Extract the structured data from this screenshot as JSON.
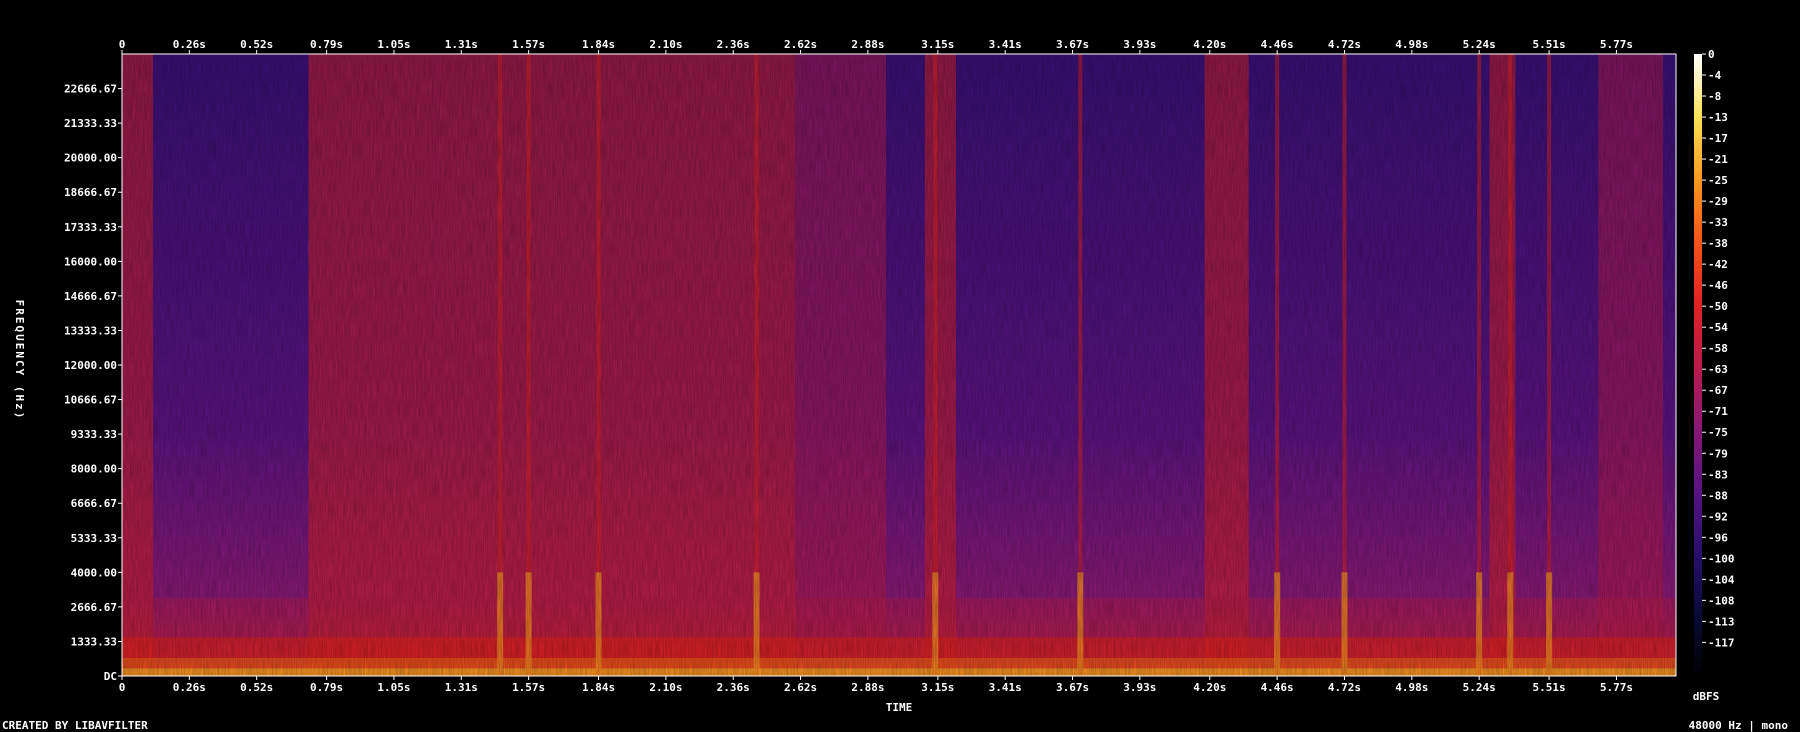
{
  "chart_data": {
    "type": "heatmap",
    "title": "",
    "xlabel": "TIME",
    "ylabel": "FREQUENCY (Hz)",
    "x_ticks": [
      "0",
      "0.26s",
      "0.52s",
      "0.79s",
      "1.05s",
      "1.31s",
      "1.57s",
      "1.84s",
      "2.10s",
      "2.36s",
      "2.62s",
      "2.88s",
      "3.15s",
      "3.41s",
      "3.67s",
      "3.93s",
      "4.20s",
      "4.46s",
      "4.72s",
      "4.98s",
      "5.24s",
      "5.51s",
      "5.77s"
    ],
    "x_tick_values": [
      0,
      0.26,
      0.52,
      0.79,
      1.05,
      1.31,
      1.57,
      1.84,
      2.1,
      2.36,
      2.62,
      2.88,
      3.15,
      3.41,
      3.67,
      3.93,
      4.2,
      4.46,
      4.72,
      4.98,
      5.24,
      5.51,
      5.77
    ],
    "xlim": [
      0,
      6.0
    ],
    "y_ticks": [
      "22666.67",
      "21333.33",
      "20000.00",
      "18666.67",
      "17333.33",
      "16000.00",
      "14666.67",
      "13333.33",
      "12000.00",
      "10666.67",
      "9333.33",
      "8000.00",
      "6666.67",
      "5333.33",
      "4000.00",
      "2666.67",
      "1333.33",
      "DC"
    ],
    "y_tick_values": [
      22666.67,
      21333.33,
      20000,
      18666.67,
      17333.33,
      16000,
      14666.67,
      13333.33,
      12000,
      10666.67,
      9333.33,
      8000,
      6666.67,
      5333.33,
      4000,
      2666.67,
      1333.33,
      0
    ],
    "ylim": [
      0,
      24000
    ],
    "colorbar": {
      "unit": "dBFS",
      "ticks": [
        "0",
        "-4",
        "-8",
        "-13",
        "-17",
        "-21",
        "-25",
        "-29",
        "-33",
        "-38",
        "-42",
        "-46",
        "-50",
        "-54",
        "-58",
        "-63",
        "-67",
        "-71",
        "-75",
        "-79",
        "-83",
        "-88",
        "-92",
        "-96",
        "-100",
        "-104",
        "-108",
        "-113",
        "-117"
      ],
      "range": [
        -120,
        0
      ]
    },
    "loud_segments_s": [
      {
        "start": 0.0,
        "end": 0.12,
        "level": -52
      },
      {
        "start": 0.72,
        "end": 1.2,
        "level": -48
      },
      {
        "start": 1.2,
        "end": 2.0,
        "level": -44
      },
      {
        "start": 2.0,
        "end": 2.6,
        "level": -52
      },
      {
        "start": 2.6,
        "end": 2.95,
        "level": -56
      },
      {
        "start": 3.1,
        "end": 3.22,
        "level": -50
      },
      {
        "start": 4.18,
        "end": 4.35,
        "level": -52
      },
      {
        "start": 5.28,
        "end": 5.38,
        "level": -48
      },
      {
        "start": 5.7,
        "end": 5.95,
        "level": -55
      }
    ],
    "transients_s": [
      1.46,
      1.57,
      1.84,
      2.45,
      3.14,
      3.7,
      4.46,
      4.72,
      5.24,
      5.36,
      5.51
    ]
  },
  "colors": {
    "background": "#000000",
    "palette": [
      "#000000",
      "#0a0a3a",
      "#2a0f6e",
      "#5a1282",
      "#8a1875",
      "#b81c4a",
      "#e02220",
      "#f2561a",
      "#f99a22",
      "#fde05a",
      "#ffffff"
    ]
  },
  "footer": {
    "left": "CREATED BY LIBAVFILTER",
    "right": "48000 Hz | mono"
  }
}
